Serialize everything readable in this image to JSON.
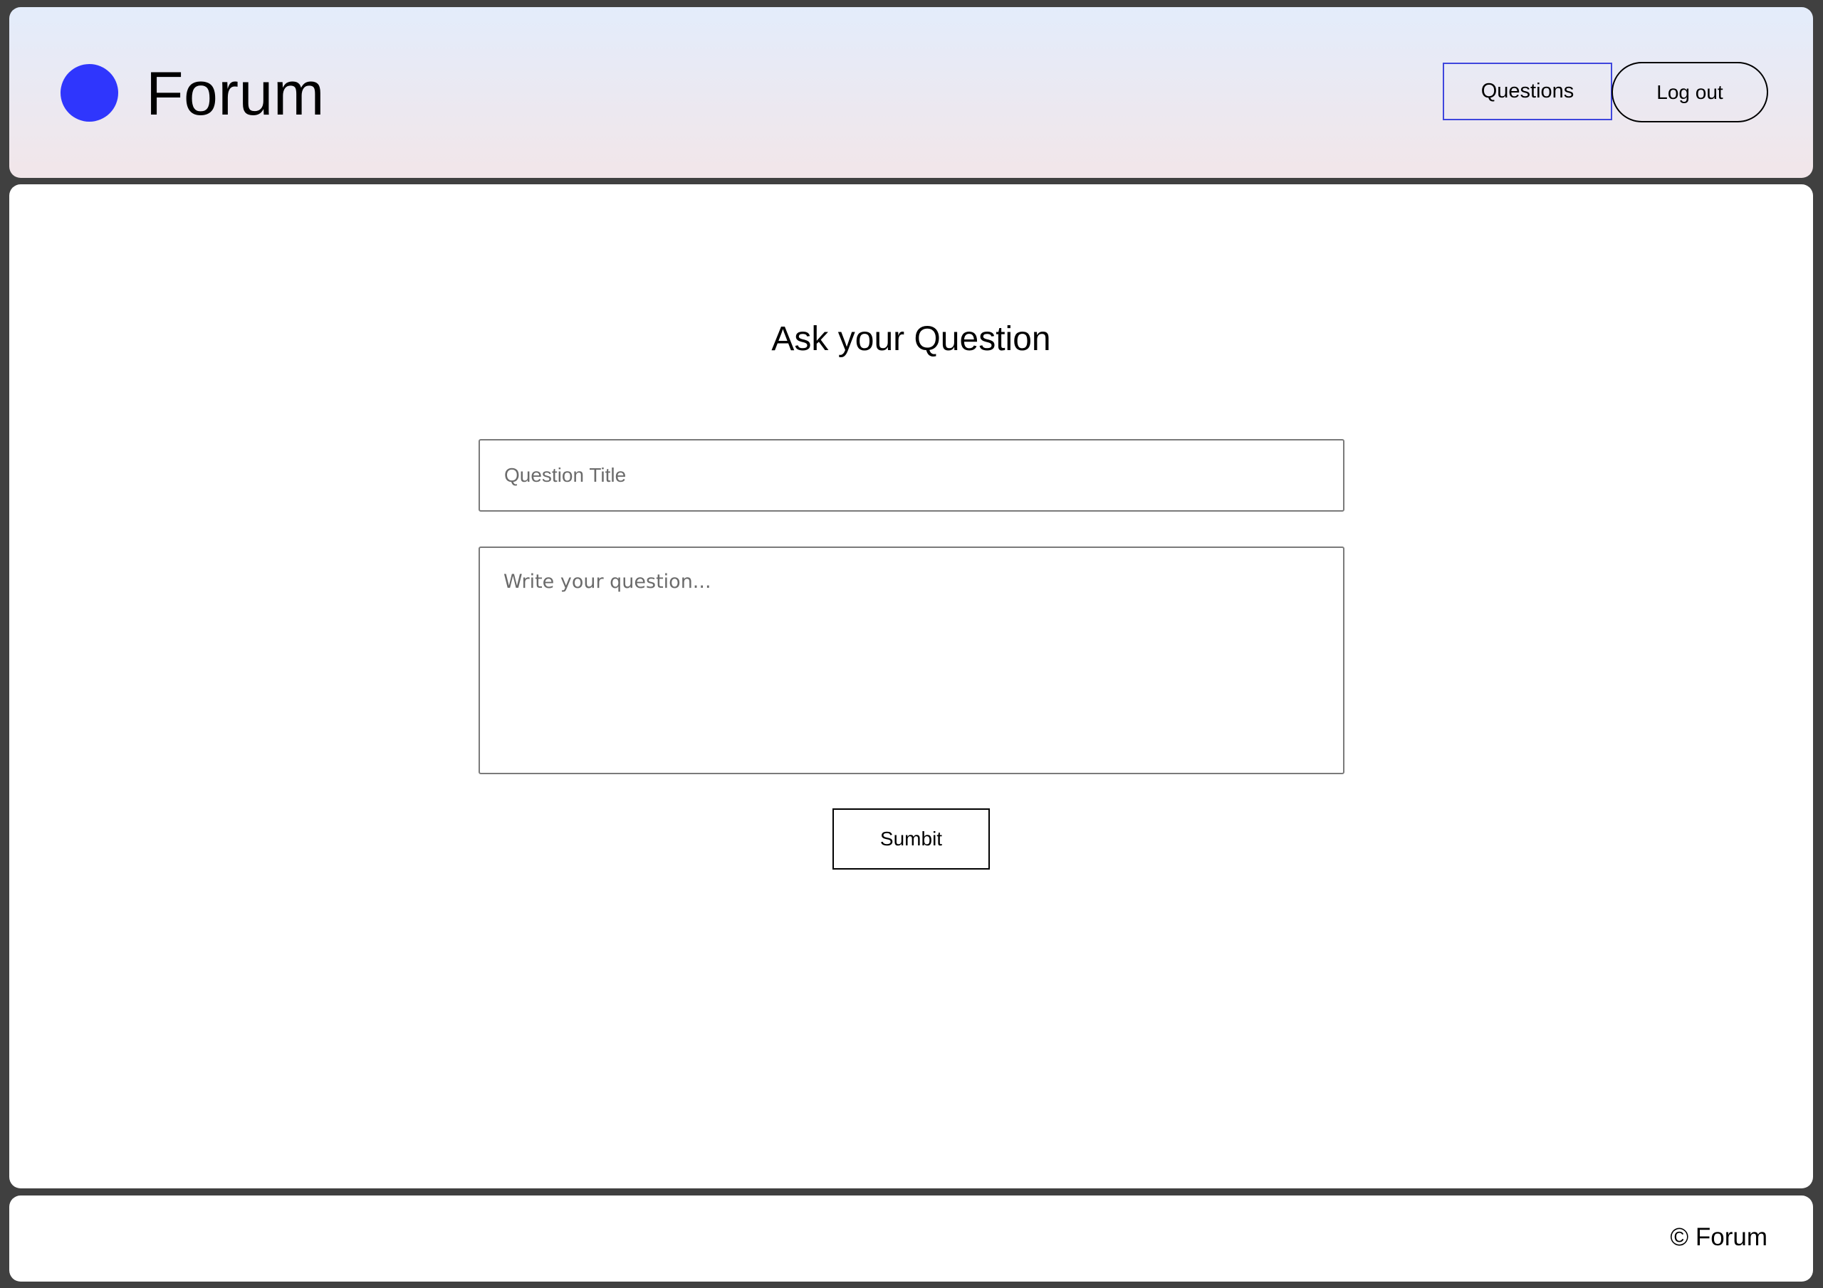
{
  "header": {
    "brand": "Forum",
    "nav": {
      "questions_label": "Questions",
      "logout_label": "Log out"
    },
    "colors": {
      "logo_dot": "#2f36fd",
      "active_nav_border": "#3f46dd"
    }
  },
  "main": {
    "title": "Ask your Question",
    "form": {
      "title_value": "",
      "title_placeholder": "Question Title",
      "body_value": "",
      "body_placeholder": "Write your question...",
      "submit_label": "Sumbit"
    }
  },
  "footer": {
    "copyright": "© Forum"
  }
}
